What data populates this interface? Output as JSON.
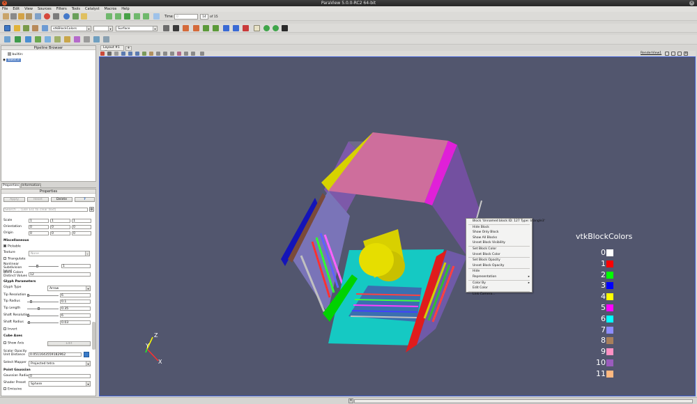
{
  "window": {
    "title": "ParaView 5.0.0-RC2 64-bit"
  },
  "menu": [
    "File",
    "Edit",
    "View",
    "Sources",
    "Filters",
    "Tools",
    "Catalyst",
    "Macros",
    "Help"
  ],
  "toolbar": {
    "time_label": "Time:",
    "time_value": "0",
    "frame_value": "14",
    "frame_total": "of 15",
    "color_by": "vtkBlockColors",
    "component": "",
    "representation": "Surface"
  },
  "pipeline": {
    "header": "Pipeline Browser",
    "root": "builtin:",
    "source": "bakis.e"
  },
  "tabs": {
    "properties": "Properties",
    "information": "Information"
  },
  "properties": {
    "header": "Properties",
    "apply": "Apply",
    "reset": "Reset",
    "delete": "Delete",
    "help": "?",
    "search_placeholder": "Search ... (use Esc to clear text)",
    "scale_label": "Scale",
    "scale": [
      "1",
      "1",
      "1"
    ],
    "orientation_label": "Orientation",
    "orientation": [
      "0",
      "0",
      "0"
    ],
    "origin_label": "Origin",
    "origin": [
      "0",
      "0",
      "0"
    ],
    "misc_section": "Miscellaneous",
    "pickable": "Pickable",
    "texture_label": "Texture",
    "texture_value": "None",
    "triangulate": "Triangulate",
    "nonlinear_label": "Nonlinear Subdivision Level",
    "nonlinear_value": "1",
    "blockcolors_label": "Block Colors Distinct Values",
    "blockcolors_value": "12",
    "glyph_section": "Glyph Parameters",
    "glyph_type_label": "Glyph Type",
    "glyph_type_value": "Arrow",
    "tip_res_label": "Tip Resolution",
    "tip_res_value": "6",
    "tip_radius_label": "Tip Radius",
    "tip_radius_value": "0.1",
    "tip_length_label": "Tip Length",
    "tip_length_value": "0.35",
    "shaft_res_label": "Shaft Resolution",
    "shaft_res_value": "6",
    "shaft_radius_label": "Shaft Radius",
    "shaft_radius_value": "0.03",
    "invert": "Invert",
    "cube_axes_section": "Cube Axes",
    "show_axis": "Show Axis",
    "edit": "Edit",
    "scalar_opacity_label": "Scalar Opacity Unit Distance",
    "scalar_opacity_value": "0.0511643559182962",
    "mapper_label": "Select Mapper",
    "mapper_value": "Projected tetra",
    "point_gaussian_section": "Point Gaussian",
    "gaussian_radius_label": "Gaussian Radius",
    "gaussian_radius_value": "0",
    "shader_label": "Shader Preset",
    "shader_value": "Sphere",
    "emissive": "Emissive"
  },
  "layout": {
    "tab": "Layout #1",
    "render_view": "RenderView1"
  },
  "context_menu": {
    "items": [
      "Block 'Unnamed block ID: 127 Type: triangle3'",
      "Hide Block",
      "Show Only Block",
      "Show All Blocks",
      "Unset Block Visibility",
      "Set Block Color",
      "Unset Block Color",
      "Set Block Opacity",
      "Unset Block Opacity",
      "Hide",
      "Representation",
      "Color By",
      "Edit Color",
      "Link Camera..."
    ]
  },
  "legend": {
    "title": "vtkBlockColors",
    "entries": [
      {
        "label": "0",
        "color": "#ffffff"
      },
      {
        "label": "1",
        "color": "#ff0000"
      },
      {
        "label": "2",
        "color": "#00ff00"
      },
      {
        "label": "3",
        "color": "#0000ff"
      },
      {
        "label": "4",
        "color": "#ffff00"
      },
      {
        "label": "5",
        "color": "#ff00ff"
      },
      {
        "label": "6",
        "color": "#00ffff"
      },
      {
        "label": "7",
        "color": "#8c8cff"
      },
      {
        "label": "8",
        "color": "#a87f5b"
      },
      {
        "label": "9",
        "color": "#ff91c4"
      },
      {
        "label": "10",
        "color": "#9a5cbd"
      },
      {
        "label": "11",
        "color": "#ffb880"
      }
    ]
  },
  "axes": {
    "x": "X",
    "y": "Y",
    "z": "Z"
  },
  "colors": {
    "viewport_bg": "#52566e",
    "accent": "#3c7bd6"
  }
}
